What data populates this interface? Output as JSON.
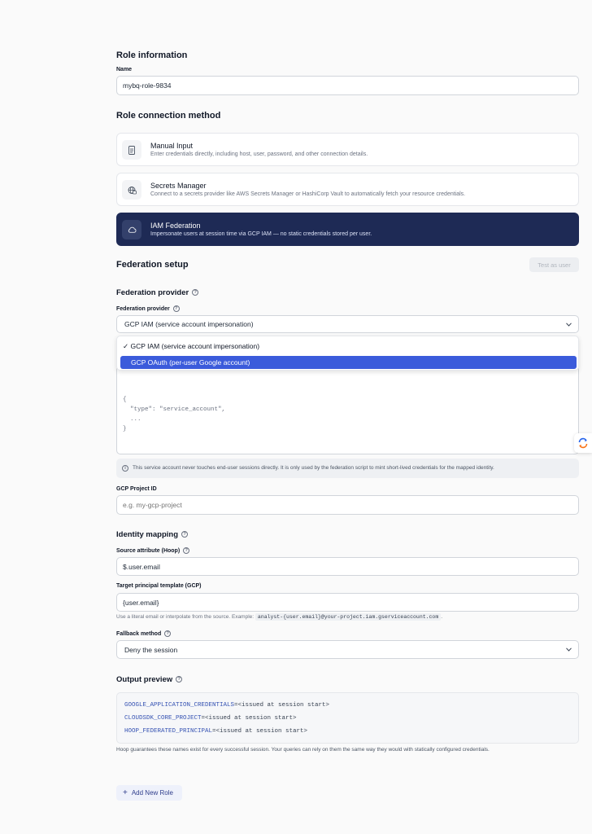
{
  "role_info": {
    "heading": "Role information",
    "name_label": "Name",
    "name_value": "mybq-role-9834"
  },
  "connection": {
    "heading": "Role connection method",
    "options": [
      {
        "title": "Manual Input",
        "desc": "Enter credentials directly, including host, user, password, and other connection details.",
        "icon": "document-icon"
      },
      {
        "title": "Secrets Manager",
        "desc": "Connect to a secrets provider like AWS Secrets Manager or HashiCorp Vault to automatically fetch your resource credentials.",
        "icon": "globe-lock-icon"
      },
      {
        "title": "IAM Federation",
        "desc": "Impersonate users at session time via GCP IAM — no static credentials stored per user.",
        "icon": "cloud-icon",
        "selected": true
      }
    ]
  },
  "federation": {
    "heading": "Federation setup",
    "test_button": "Test as user",
    "provider_heading": "Federation provider",
    "provider_label": "Federation provider",
    "provider_value": "GCP IAM (service account impersonation)",
    "dropdown_options": [
      {
        "label": "GCP IAM (service account impersonation)",
        "checked": true
      },
      {
        "label": "GCP OAuth (per-user Google account)",
        "highlighted": true
      }
    ],
    "json_lines": [
      "{",
      "  \"type\": \"service_account\",",
      "  ...",
      "}"
    ],
    "info_note": "This service account never touches end-user sessions directly. It is only used by the federation script to mint short-lived credentials for the mapped identity.",
    "project_label": "GCP Project ID",
    "project_placeholder": "e.g. my-gcp-project"
  },
  "identity": {
    "heading": "Identity mapping",
    "source_label": "Source attribute (Hoop)",
    "source_value": "$.user.email",
    "target_label": "Target principal template (GCP)",
    "target_value": "{user.email}",
    "hint_prefix": "Use a literal email or interpolate from the source. Example:",
    "hint_code": "analyst-{user.email}@your-project.iam.gserviceaccount.com",
    "hint_suffix": ".",
    "fallback_label": "Fallback method",
    "fallback_value": "Deny the session"
  },
  "output": {
    "heading": "Output preview",
    "lines": [
      {
        "key": "GOOGLE_APPLICATION_CREDENTIALS",
        "val": "=<issued at session start>"
      },
      {
        "key": "CLOUDSDK_CORE_PROJECT",
        "val": "=<issued at session start>"
      },
      {
        "key": "HOOP_FEDERATED_PRINCIPAL",
        "val": "=<issued at session start>"
      }
    ],
    "note": "Hoop guarantees these names exist for every successful session. Your queries can rely on them the same way they would with statically configured credentials."
  },
  "add_button": "Add New Role",
  "colors": {
    "accent": "#1e2a55",
    "highlight": "#3b5bdb",
    "key": "#3451b2"
  }
}
